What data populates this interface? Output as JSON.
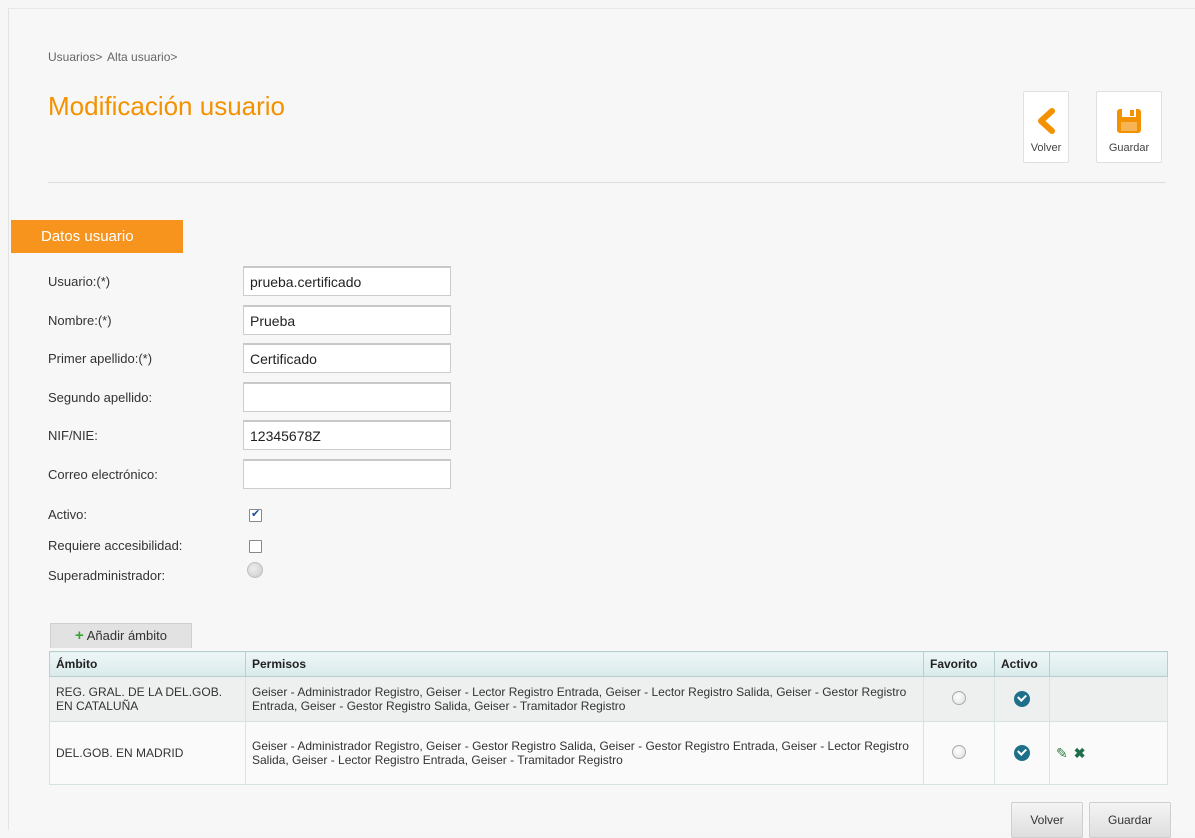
{
  "breadcrumb": [
    "Usuarios>",
    "Alta usuario>"
  ],
  "page_title": "Modificación usuario",
  "toolbar": {
    "back_label": "Volver",
    "save_label": "Guardar"
  },
  "section_title": "Datos usuario",
  "fields": [
    {
      "label": "Usuario:(*)",
      "value": "prueba.certificado"
    },
    {
      "label": "Nombre:(*)",
      "value": "Prueba"
    },
    {
      "label": "Primer apellido:(*)",
      "value": "Certificado"
    },
    {
      "label": "Segundo apellido:",
      "value": ""
    },
    {
      "label": "NIF/NIE:",
      "value": "12345678Z"
    },
    {
      "label": "Correo electrónico:",
      "value": ""
    }
  ],
  "checks": [
    {
      "label": "Activo:",
      "checked": true
    },
    {
      "label": "Requiere accesibilidad:",
      "checked": false
    }
  ],
  "superadmin_label": "Superadministrador:",
  "add_scope_label": "Añadir ámbito",
  "table": {
    "headers": [
      "Ámbito",
      "Permisos",
      "Favorito",
      "Activo",
      ""
    ],
    "rows": [
      {
        "ambito": "REG. GRAL. DE LA DEL.GOB. EN CATALUÑA",
        "permisos": "Geiser - Administrador Registro, Geiser - Lector Registro Entrada, Geiser - Lector Registro Salida, Geiser - Gestor Registro Entrada, Geiser - Gestor Registro Salida, Geiser - Tramitador Registro"
      },
      {
        "ambito": "DEL.GOB. EN MADRID",
        "permisos": "Geiser - Administrador Registro, Geiser - Gestor Registro Salida, Geiser - Gestor Registro Entrada, Geiser - Lector Registro Salida, Geiser - Lector Registro Entrada, Geiser - Tramitador Registro"
      }
    ]
  },
  "bottom": {
    "back_label": "Volver",
    "save_label": "Guardar"
  },
  "colors": {
    "accent": "#f39200",
    "tab": "#f7941d",
    "active_icon": "#1e6f8a"
  }
}
